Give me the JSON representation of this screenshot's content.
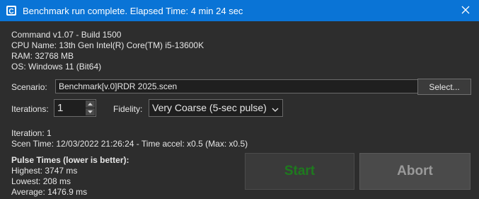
{
  "window": {
    "title": "Benchmark run complete. Elapsed Time: 4 min 24 sec",
    "app_icon": "app-icon",
    "close_icon": "close-icon",
    "titlebar_color": "#0a74d6"
  },
  "system_info": {
    "command": "Command v1.07 - Build 1500",
    "cpu": "CPU Name: 13th Gen Intel(R) Core(TM) i5-13600K",
    "ram": "RAM: 32768 MB",
    "os": "OS: Windows 11 (Bit64)"
  },
  "scenario": {
    "label": "Scenario:",
    "value": "Benchmark[v.0]RDR 2025.scen",
    "select_button": "Select..."
  },
  "iterations": {
    "label": "Iterations:",
    "value": "1"
  },
  "fidelity": {
    "label": "Fidelity:",
    "selected": "Very Coarse (5-sec pulse)"
  },
  "status": {
    "iteration": "Iteration: 1",
    "scen_time": "Scen Time: 12/03/2022 21:26:24 - Time accel: x0.5 (Max: x0.5)"
  },
  "pulse": {
    "title": "Pulse Times (lower is better):",
    "highest": "Highest: 3747 ms",
    "lowest": "Lowest: 208 ms",
    "average": "Average: 1476.9 ms"
  },
  "actions": {
    "start": "Start",
    "abort": "Abort",
    "start_color": "#1e7a1e"
  }
}
